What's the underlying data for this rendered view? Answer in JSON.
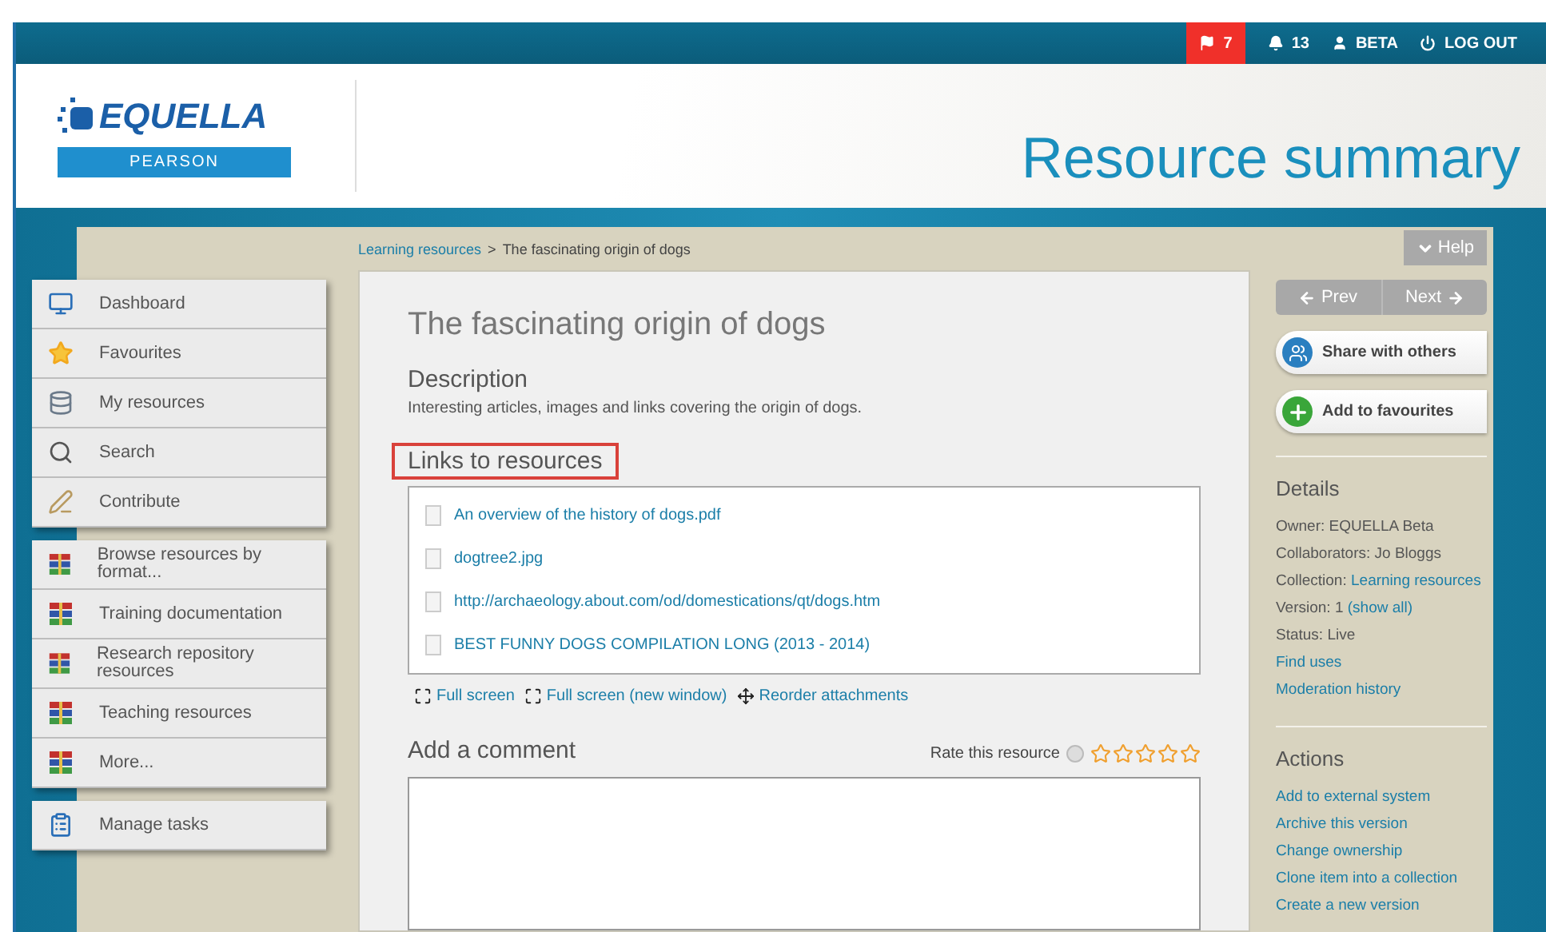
{
  "top_bar": {
    "flag_count": "7",
    "notification_count": "13",
    "user": "BETA",
    "logout": "LOG OUT"
  },
  "header": {
    "logo_text": "EQUELLA",
    "logo_sub": "PEARSON",
    "title": "Resource summary"
  },
  "breadcrumb": {
    "link": "Learning resources",
    "separator": ">",
    "current": "The fascinating origin of dogs"
  },
  "help_button": "Help",
  "nav_groups": [
    [
      {
        "kind": "dashboard",
        "label": "Dashboard"
      },
      {
        "kind": "favourites",
        "label": "Favourites"
      },
      {
        "kind": "resources",
        "label": "My resources"
      },
      {
        "kind": "search",
        "label": "Search"
      },
      {
        "kind": "contribute",
        "label": "Contribute"
      }
    ],
    [
      {
        "kind": "books",
        "label": "Browse resources by format..."
      },
      {
        "kind": "books",
        "label": "Training documentation"
      },
      {
        "kind": "books",
        "label": "Research repository resources"
      },
      {
        "kind": "books",
        "label": "Teaching resources"
      },
      {
        "kind": "books",
        "label": "More..."
      }
    ],
    [
      {
        "kind": "tasks",
        "label": "Manage tasks"
      }
    ]
  ],
  "item": {
    "title": "The fascinating origin of dogs",
    "description_heading": "Description",
    "description": "Interesting articles, images and links covering the origin of dogs.",
    "links_heading": "Links to resources",
    "attachments": [
      "An overview of the history of dogs.pdf",
      "dogtree2.jpg",
      "http://archaeology.about.com/od/domestications/qt/dogs.htm",
      "BEST FUNNY DOGS COMPILATION LONG (2013 - 2014)"
    ],
    "attachment_actions": [
      {
        "kind": "fullscreen",
        "label": "Full screen"
      },
      {
        "kind": "fullscreen",
        "label": "Full screen (new window)"
      },
      {
        "kind": "reorder",
        "label": "Reorder attachments"
      }
    ],
    "comment_heading": "Add a comment",
    "rate_label": "Rate this resource",
    "stars": 0
  },
  "pager": {
    "prev": "Prev",
    "next": "Next"
  },
  "side_buttons": [
    {
      "kind": "share",
      "label": "Share with others"
    },
    {
      "kind": "favourite",
      "label": "Add to favourites"
    }
  ],
  "details": {
    "heading": "Details",
    "rows": [
      {
        "label": "Owner: EQUELLA Beta"
      },
      {
        "label": "Collaborators: Jo Bloggs"
      },
      {
        "label": "Collection:",
        "link": "Learning resources"
      },
      {
        "label": "Version: 1",
        "link": "(show all)"
      },
      {
        "label": "Status: Live"
      },
      {
        "link": "Find uses"
      },
      {
        "link": "Moderation history"
      }
    ]
  },
  "actions": {
    "heading": "Actions",
    "links": [
      "Add to external system",
      "Archive this version",
      "Change ownership",
      "Clone item into a collection",
      "Create a new version"
    ]
  }
}
